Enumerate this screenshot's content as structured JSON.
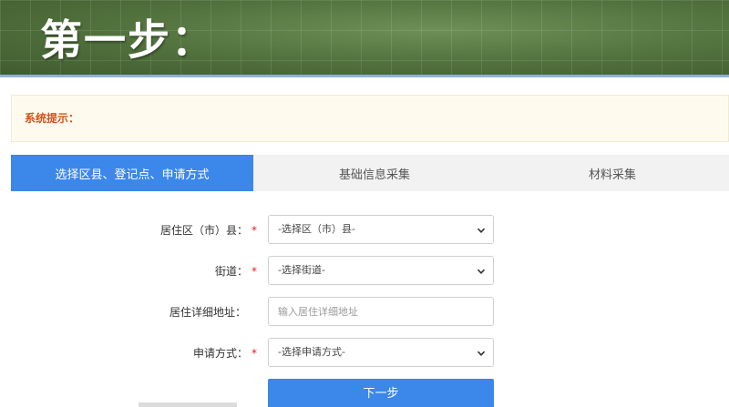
{
  "banner": {
    "title": "第一步："
  },
  "notice": {
    "label": "系统提示："
  },
  "tabs": [
    {
      "label": "选择区县、登记点、申请方式",
      "active": true
    },
    {
      "label": "基础信息采集",
      "active": false
    },
    {
      "label": "材料采集",
      "active": false
    }
  ],
  "form": {
    "district": {
      "label": "居住区（市）县：",
      "required": "*",
      "selected": "-选择区（市）县-"
    },
    "street": {
      "label": "街道：",
      "required": "*",
      "selected": "-选择街道-"
    },
    "address": {
      "label": "居住详细地址：",
      "placeholder": "输入居住详细地址"
    },
    "method": {
      "label": "申请方式：",
      "required": "*",
      "selected": "-选择申请方式-"
    }
  },
  "actions": {
    "next_label": "下一步"
  },
  "colors": {
    "accent": "#3b87ea",
    "notice_text": "#d2541c",
    "required": "#e02020"
  },
  "icons": {
    "select_arrow": "chevron-down-icon"
  }
}
